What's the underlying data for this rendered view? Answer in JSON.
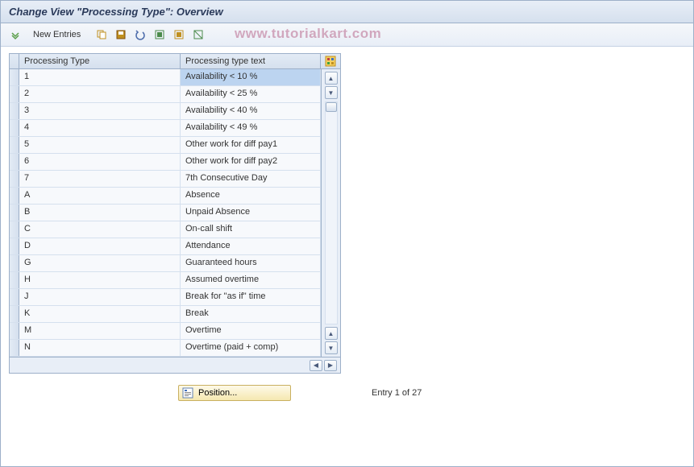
{
  "title": "Change View \"Processing Type\": Overview",
  "watermark": "www.tutorialkart.com",
  "toolbar": {
    "new_entries_label": "New Entries"
  },
  "table": {
    "headers": {
      "type": "Processing Type",
      "text": "Processing type text"
    },
    "rows": [
      {
        "type": "1",
        "text": "Availability < 10 %",
        "selected": true
      },
      {
        "type": "2",
        "text": "Availability < 25 %"
      },
      {
        "type": "3",
        "text": "Availability < 40 %"
      },
      {
        "type": "4",
        "text": "Availability < 49 %"
      },
      {
        "type": "5",
        "text": "Other work for diff pay1"
      },
      {
        "type": "6",
        "text": "Other work for diff pay2"
      },
      {
        "type": "7",
        "text": "7th Consecutive Day"
      },
      {
        "type": "A",
        "text": "Absence"
      },
      {
        "type": "B",
        "text": "Unpaid Absence"
      },
      {
        "type": "C",
        "text": "On-call shift"
      },
      {
        "type": "D",
        "text": "Attendance"
      },
      {
        "type": "G",
        "text": "Guaranteed hours"
      },
      {
        "type": "H",
        "text": "Assumed overtime"
      },
      {
        "type": "J",
        "text": "Break for \"as if\" time"
      },
      {
        "type": "K",
        "text": "Break"
      },
      {
        "type": "M",
        "text": "Overtime"
      },
      {
        "type": "N",
        "text": "Overtime (paid + comp)"
      }
    ]
  },
  "footer": {
    "position_label": "Position...",
    "entry_text": "Entry 1 of 27"
  }
}
